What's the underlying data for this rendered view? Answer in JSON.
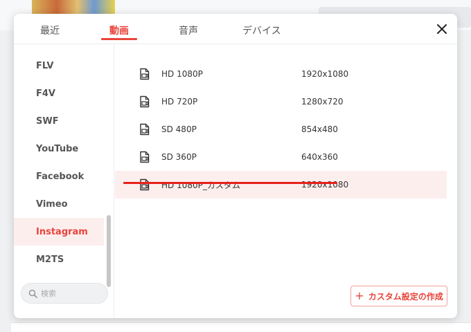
{
  "dialog": {
    "tabs": [
      {
        "label": "最近",
        "active": false
      },
      {
        "label": "動画",
        "active": true
      },
      {
        "label": "音声",
        "active": false
      },
      {
        "label": "デバイス",
        "active": false
      }
    ],
    "close_icon": "close-icon"
  },
  "sidebar": {
    "items": [
      {
        "label": "FLV",
        "active": false
      },
      {
        "label": "F4V",
        "active": false
      },
      {
        "label": "SWF",
        "active": false
      },
      {
        "label": "YouTube",
        "active": false
      },
      {
        "label": "Facebook",
        "active": false
      },
      {
        "label": "Vimeo",
        "active": false
      },
      {
        "label": "Instagram",
        "active": true
      },
      {
        "label": "M2TS",
        "active": false
      }
    ],
    "search": {
      "placeholder": "検索",
      "value": ""
    }
  },
  "presets": [
    {
      "name": "HD 1080P",
      "resolution": "1920x1080",
      "selected": false
    },
    {
      "name": "HD 720P",
      "resolution": "1280x720",
      "selected": false
    },
    {
      "name": "SD 480P",
      "resolution": "854x480",
      "selected": false
    },
    {
      "name": "SD 360P",
      "resolution": "640x360",
      "selected": false
    },
    {
      "name": "HD 1080P_カスタム",
      "resolution": "1920x1080",
      "selected": true
    }
  ],
  "create_button": {
    "label": "カスタム設定の作成",
    "icon": "plus-icon"
  },
  "colors": {
    "accent": "#e8443a",
    "highlight": "#fdeeee",
    "underline": "#e8201a"
  }
}
